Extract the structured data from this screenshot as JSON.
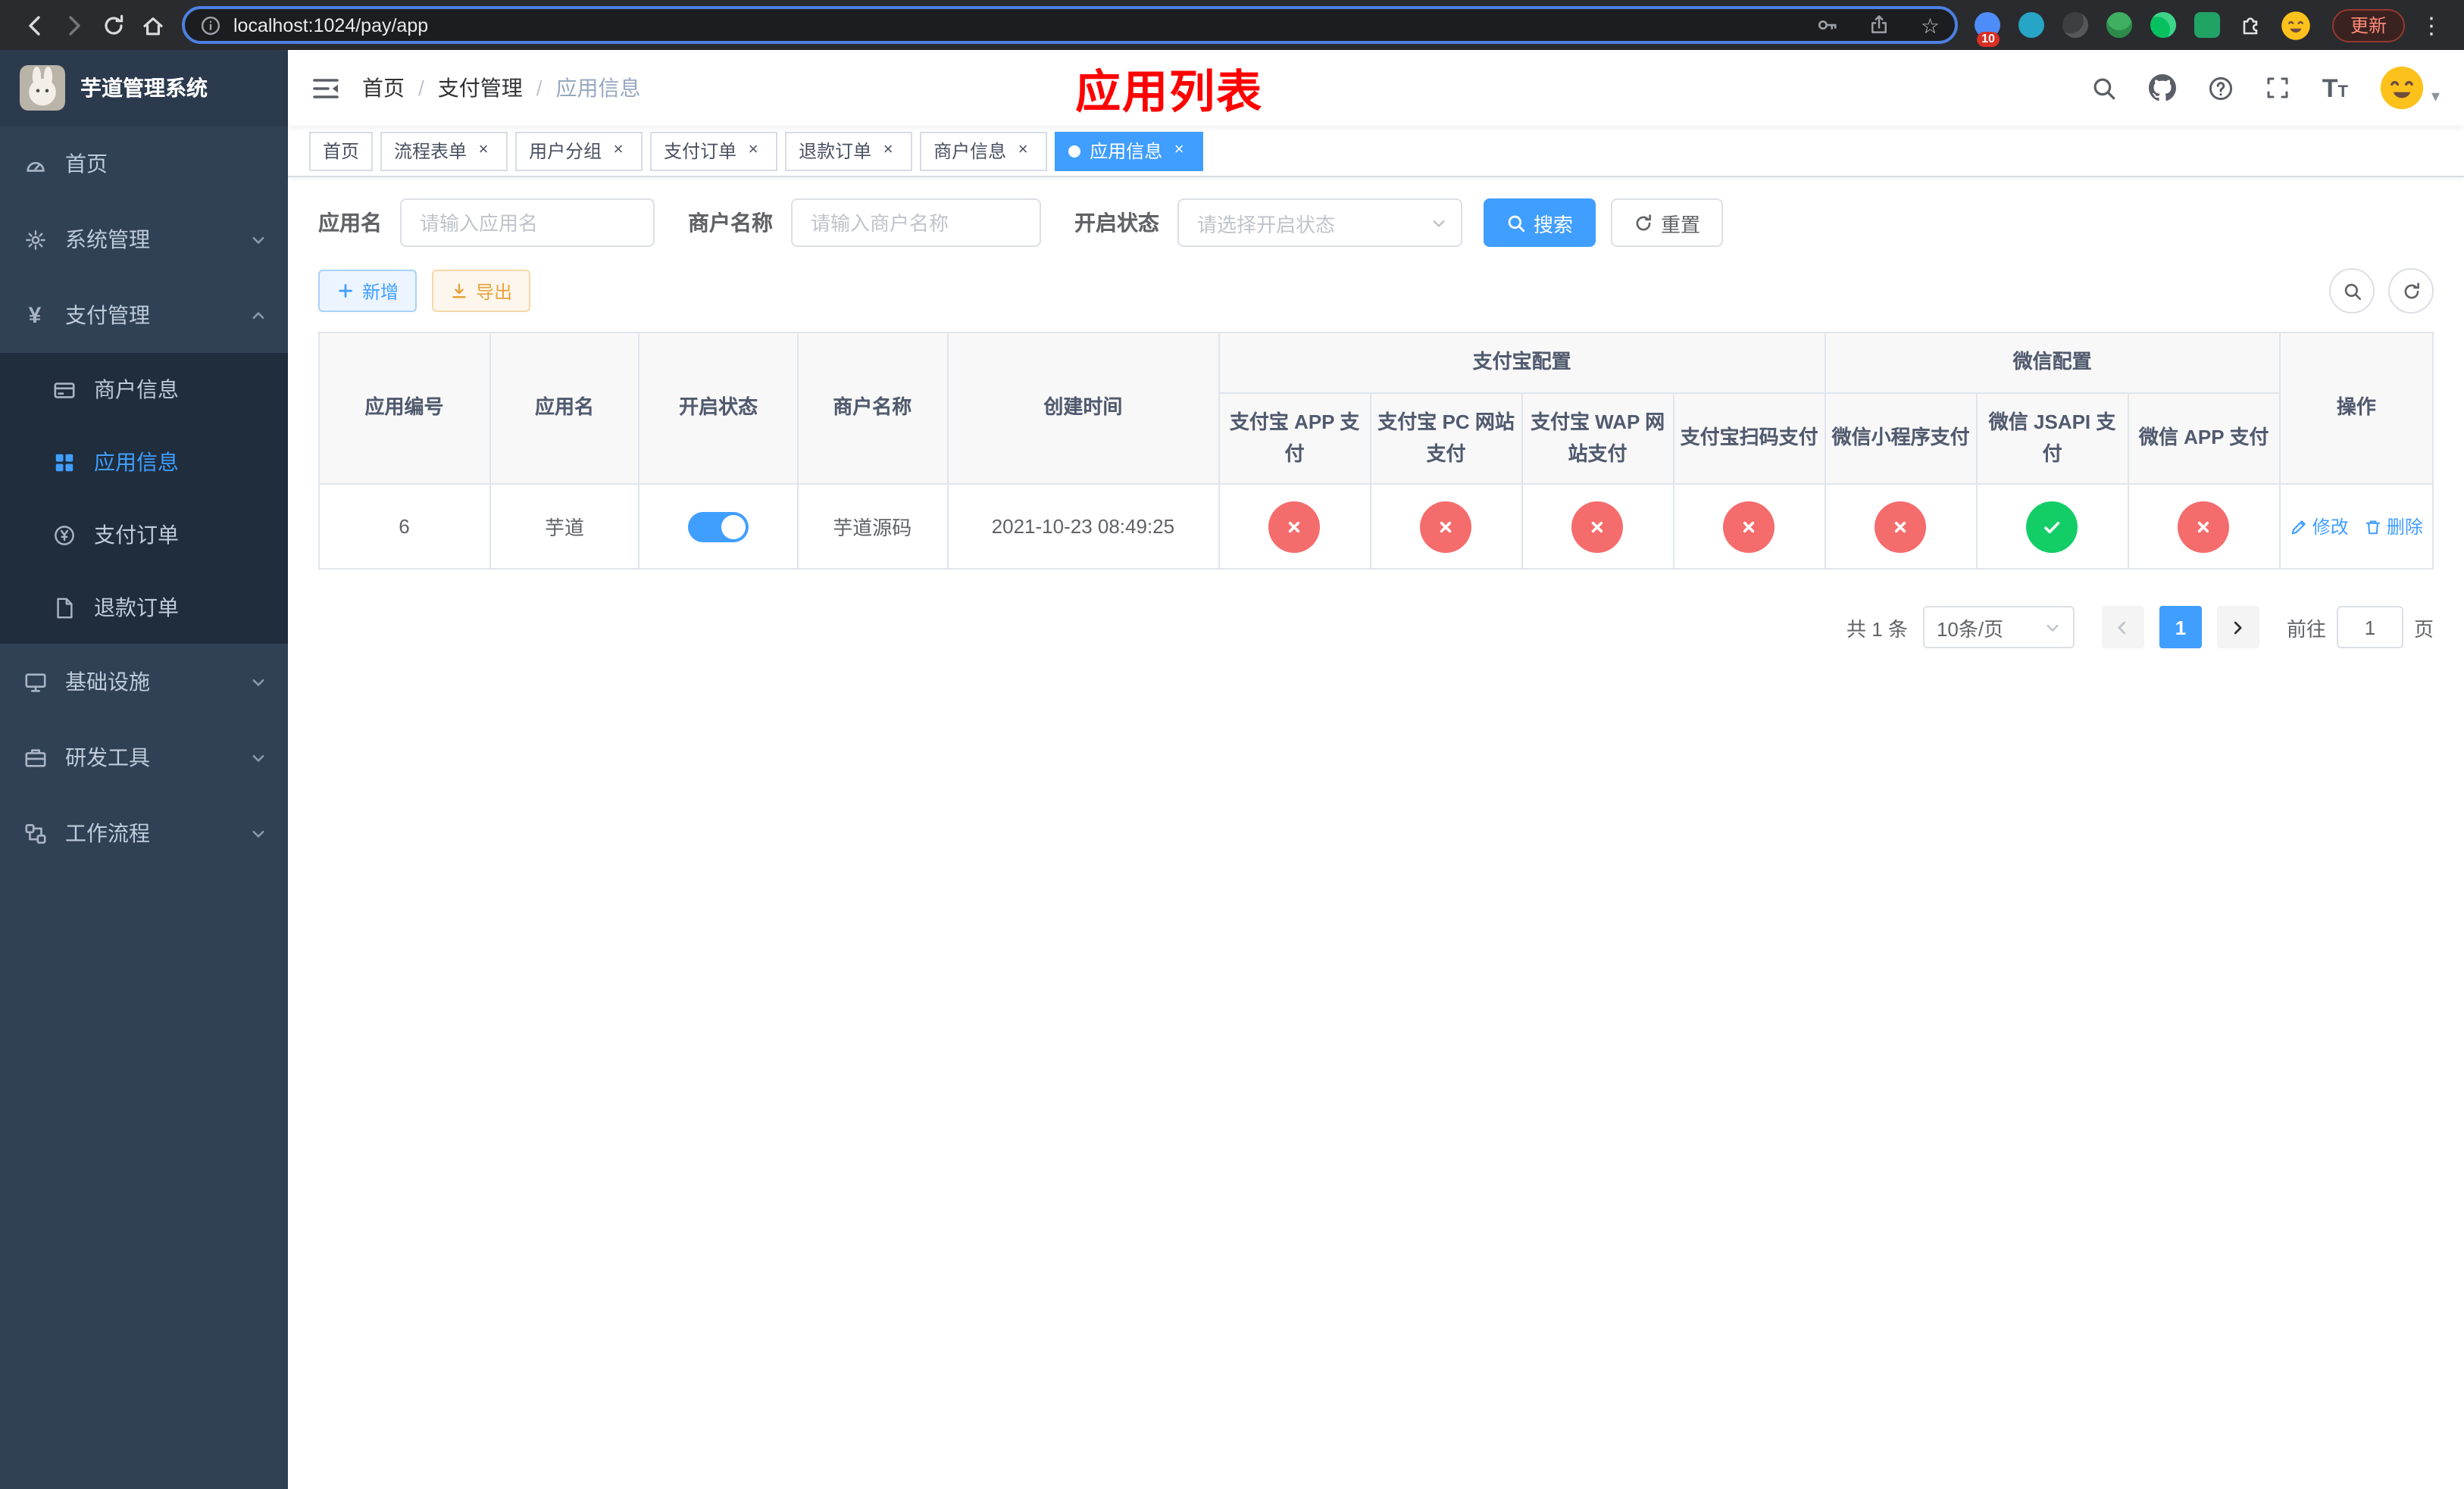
{
  "colors": {
    "primary": "#409EFF",
    "success": "#13ce66",
    "danger": "#f56c6c",
    "warning": "#e6a23c",
    "sidebar_bg": "#304156",
    "submenu_bg": "#1f2d3d",
    "annotation": "#fe0000"
  },
  "icons": {
    "star": "☆",
    "dots": "⋮",
    "yen": "¥",
    "close": "×",
    "caret_down": "▾",
    "font_size_big": "T",
    "font_size_small": "T"
  },
  "browser": {
    "url": "localhost:1024/pay/app",
    "update_label": "更新",
    "extension_badge": "10"
  },
  "app": {
    "logo_title": "芋道管理系统"
  },
  "sidebar": {
    "items": [
      {
        "label": "首页"
      },
      {
        "label": "系统管理"
      },
      {
        "label": "支付管理"
      },
      {
        "label": "基础设施"
      },
      {
        "label": "研发工具"
      },
      {
        "label": "工作流程"
      }
    ],
    "submenu": [
      {
        "label": "商户信息"
      },
      {
        "label": "应用信息",
        "active": true
      },
      {
        "label": "支付订单"
      },
      {
        "label": "退款订单"
      }
    ]
  },
  "header": {
    "breadcrumb": [
      "首页",
      "支付管理",
      "应用信息"
    ],
    "annotation_title": "应用列表"
  },
  "tabs": [
    {
      "label": "首页",
      "closable": false
    },
    {
      "label": "流程表单",
      "closable": true
    },
    {
      "label": "用户分组",
      "closable": true
    },
    {
      "label": "支付订单",
      "closable": true
    },
    {
      "label": "退款订单",
      "closable": true
    },
    {
      "label": "商户信息",
      "closable": true
    },
    {
      "label": "应用信息",
      "closable": true,
      "active": true
    }
  ],
  "filters": {
    "app_name_label": "应用名",
    "app_name_placeholder": "请输入应用名",
    "merchant_label": "商户名称",
    "merchant_placeholder": "请输入商户名称",
    "status_label": "开启状态",
    "status_placeholder": "请选择开启状态",
    "search_label": "搜索",
    "reset_label": "重置"
  },
  "toolbar": {
    "add_label": "新增",
    "export_label": "导出"
  },
  "table": {
    "columns": {
      "app_id": "应用编号",
      "app_name": "应用名",
      "status": "开启状态",
      "merchant": "商户名称",
      "created_at": "创建时间",
      "alipay_group": "支付宝配置",
      "wechat_group": "微信配置",
      "alipay_app": "支付宝 APP 支付",
      "alipay_pc": "支付宝 PC 网站支付",
      "alipay_wap": "支付宝 WAP 网站支付",
      "alipay_qr": "支付宝扫码支付",
      "wx_mini": "微信小程序支付",
      "wx_jsapi": "微信 JSAPI 支付",
      "wx_app": "微信 APP 支付",
      "actions": "操作"
    },
    "rows": [
      {
        "app_id": "6",
        "app_name": "芋道",
        "status_enabled": true,
        "merchant": "芋道源码",
        "created_at": "2021-10-23 08:49:25",
        "alipay_app": false,
        "alipay_pc": false,
        "alipay_wap": false,
        "alipay_qr": false,
        "wx_mini": false,
        "wx_jsapi": true,
        "wx_app": false,
        "edit_label": "修改",
        "delete_label": "删除"
      }
    ]
  },
  "pagination": {
    "total_text": "共 1 条",
    "page_size_text": "10条/页",
    "current_page": "1",
    "goto_label": "前往",
    "goto_value": "1",
    "page_unit_label": "页"
  }
}
